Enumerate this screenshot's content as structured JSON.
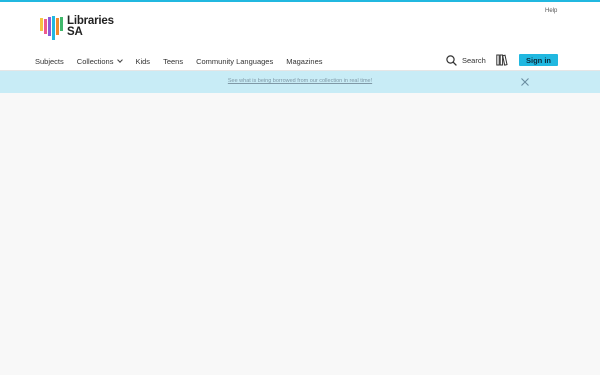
{
  "brand": {
    "logo_line1": "Libraries",
    "logo_line2": "SA",
    "bar_colors": [
      "#f5c542",
      "#ee5a8f",
      "#8c5ad6",
      "#21b8e0",
      "#f08a2c",
      "#3fb86b"
    ]
  },
  "header": {
    "help_label": "Help"
  },
  "nav": {
    "items": [
      {
        "label": "Subjects"
      },
      {
        "label": "Collections",
        "has_dropdown": true
      },
      {
        "label": "Kids"
      },
      {
        "label": "Teens"
      },
      {
        "label": "Community Languages"
      },
      {
        "label": "Magazines"
      }
    ],
    "search_label": "Search",
    "library_icon": "library-books-icon",
    "signin_label": "Sign in"
  },
  "banner": {
    "text": "See what is being borrowed from our collection in real time!",
    "close_icon": "close-icon"
  },
  "colors": {
    "accent": "#21b8e0",
    "banner_bg": "#c8ecf6",
    "page_bg": "#f8f8f8"
  }
}
